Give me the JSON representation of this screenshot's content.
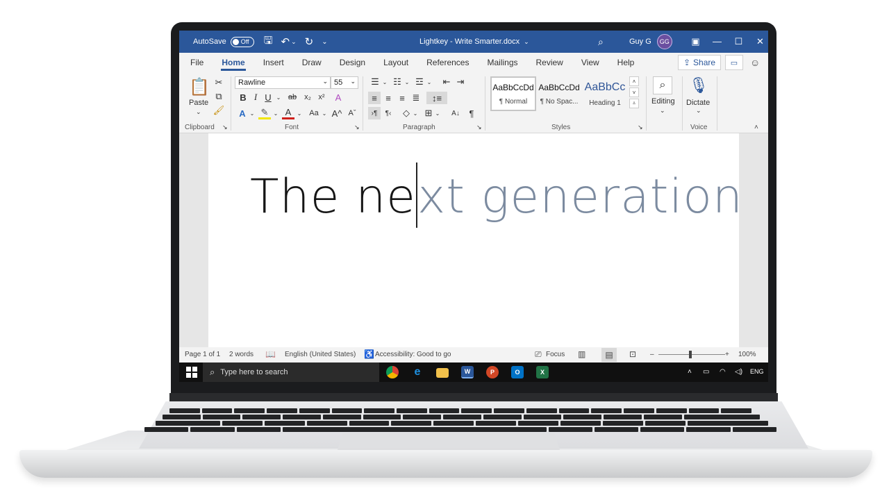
{
  "window": {
    "autosave_label": "AutoSave",
    "autosave_state": "Off",
    "doc_title": "Lightkey - Write Smarter.docx",
    "title_caret": "⌄",
    "user_name": "Guy G",
    "user_initials": "GG",
    "colors": {
      "titlebar": "#2b579a",
      "accent": "#2b579a"
    }
  },
  "tabs": [
    "File",
    "Home",
    "Insert",
    "Draw",
    "Design",
    "Layout",
    "References",
    "Mailings",
    "Review",
    "View",
    "Help"
  ],
  "active_tab": "Home",
  "toolbar": {
    "share_label": "Share",
    "paste_label": "Paste",
    "font_name": "Rawline",
    "font_size": "55",
    "editing_label": "Editing",
    "dictate_label": "Dictate"
  },
  "ribbon_groups": {
    "clipboard": "Clipboard",
    "font": "Font",
    "paragraph": "Paragraph",
    "styles": "Styles",
    "voice": "Voice"
  },
  "styles": [
    {
      "sample": "AaBbCcDd",
      "name": "¶ Normal"
    },
    {
      "sample": "AaBbCcDd",
      "name": "¶ No Spac..."
    },
    {
      "sample": "AaBbCc",
      "name": "Heading 1"
    }
  ],
  "document": {
    "typed_text": "The ne",
    "suggested_text": "xt generation",
    "colors": {
      "typed": "#161616",
      "suggestion": "#7c8ba0"
    }
  },
  "statusbar": {
    "page": "Page 1 of 1",
    "words": "2 words",
    "language": "English (United States)",
    "accessibility": "Accessibility: Good to go",
    "focus": "Focus",
    "zoom": "100%",
    "zoom_minus": "–",
    "zoom_plus": "+"
  },
  "taskbar": {
    "search_placeholder": "Type here to search",
    "language": "ENG",
    "apps": [
      "chrome-icon",
      "edge-icon",
      "file-explorer-icon",
      "word-icon",
      "powerpoint-icon",
      "outlook-icon",
      "excel-icon"
    ]
  }
}
